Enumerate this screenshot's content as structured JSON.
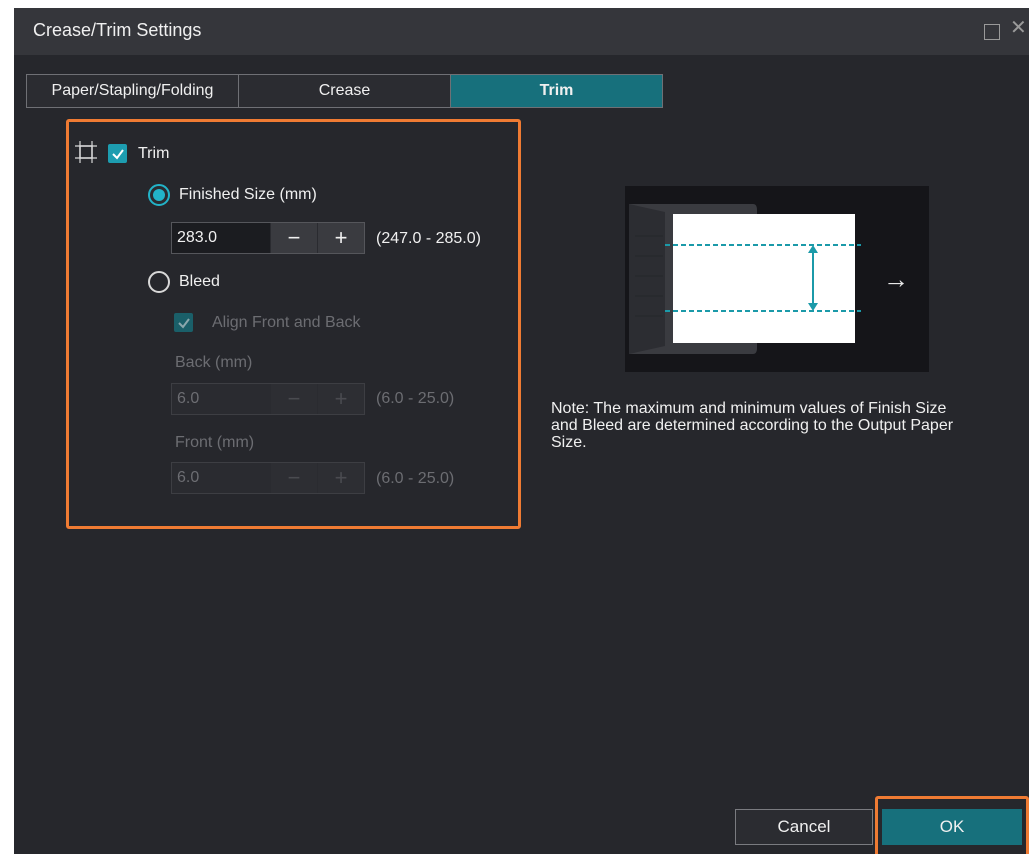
{
  "window": {
    "title": "Crease/Trim Settings",
    "maximize_icon": "square-outline-icon",
    "close_icon": "close-icon"
  },
  "tabs": [
    {
      "label": "Paper/Stapling/Folding",
      "active": false
    },
    {
      "label": "Crease",
      "active": false
    },
    {
      "label": "Trim",
      "active": true
    }
  ],
  "trim": {
    "icon": "trim-crop-icon",
    "checkbox_label": "Trim",
    "checked": true,
    "finished_size": {
      "label": "Finished Size (mm)",
      "selected": true,
      "value": "283.0",
      "decrement": "−",
      "increment": "+",
      "range": "(247.0 - 285.0)"
    },
    "bleed": {
      "label": "Bleed",
      "selected": false,
      "align_label": "Align Front and Back",
      "align_checked": true,
      "back_label": "Back (mm)",
      "back_value": "6.0",
      "back_range": "(6.0 - 25.0)",
      "front_label": "Front (mm)",
      "front_value": "6.0",
      "front_range": "(6.0 - 25.0)",
      "decrement": "−",
      "increment": "+"
    }
  },
  "preview": {
    "arrow_glyph": "→"
  },
  "note": "Note: The maximum and minimum values of Finish Size and Bleed are determined according to the Output Paper Size.",
  "buttons": {
    "cancel": "Cancel",
    "ok": "OK"
  },
  "colors": {
    "accent": "#17707c",
    "highlight": "#ef7b33",
    "background": "#26272c"
  }
}
